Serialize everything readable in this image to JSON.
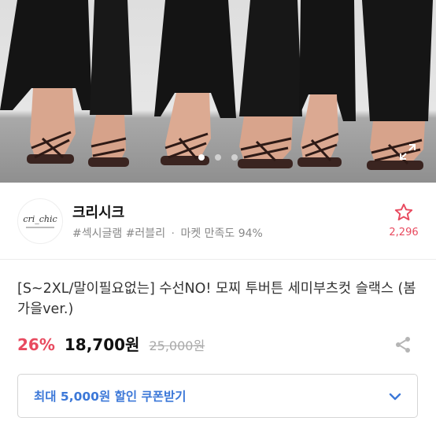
{
  "gallery": {
    "image_icon": "sandals-product-photo",
    "dots": [
      true,
      false,
      false
    ],
    "expand_icon": "expand-icon"
  },
  "shop": {
    "logo_text": "cri_chic",
    "name": "크리시크",
    "tags": "#섹시글램 #러블리",
    "separator": "·",
    "satisfaction": "마켓 만족도 94%",
    "favorite_count": "2,296",
    "favorite_icon": "star-icon"
  },
  "product": {
    "title": "[S~2XL/말이필요없는] 수선NO! 모찌 투버튼 세미부츠컷 슬랙스 (봄가을ver.)",
    "discount": "26%",
    "price": "18,700원",
    "original_price": "25,000원",
    "share_icon": "share-icon"
  },
  "coupon": {
    "label": "최대 5,000원 할인 쿠폰받기",
    "icon": "chevron-down-icon"
  },
  "colors": {
    "accent": "#e84a5f",
    "link": "#3c78d8"
  }
}
